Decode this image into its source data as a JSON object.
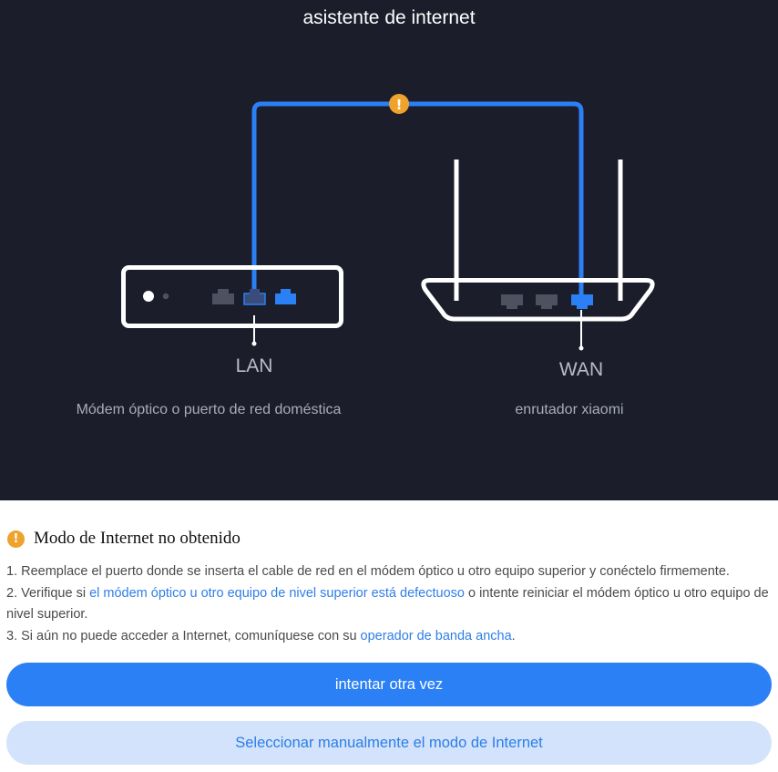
{
  "header": {
    "title": "asistente de internet"
  },
  "diagram": {
    "warning_glyph": "!",
    "warning_icon": "warning-icon",
    "lan_label": "LAN",
    "wan_label": "WAN",
    "modem_caption": "Módem óptico o puerto de red doméstica",
    "router_caption": "enrutador xiaomi",
    "cable_color": "#2b80f5",
    "warning_color": "#efa22c"
  },
  "error": {
    "icon": "warning-icon",
    "glyph": "!",
    "title": "Modo de Internet no obtenido",
    "step1": "1. Reemplace el puerto donde se inserta el cable de red en el módem óptico u otro equipo superior y conéctelo firmemente.",
    "step2_prefix": "2. Verifique si ",
    "step2_link": "el módem óptico u otro equipo de nivel superior está defectuoso",
    "step2_suffix": " o intente reiniciar el módem óptico u otro equipo de nivel superior.",
    "step3_prefix": "3. Si aún no puede acceder a Internet, comuníquese con su ",
    "step3_link": "operador de banda ancha",
    "step3_suffix": "."
  },
  "actions": {
    "retry_label": "intentar otra vez",
    "manual_label": "Seleccionar manualmente el modo de Internet"
  },
  "colors": {
    "hero_background": "#1b1d2b",
    "primary": "#2b80f5",
    "secondary_background": "#d3e3fb",
    "link": "#2f7ee8"
  }
}
